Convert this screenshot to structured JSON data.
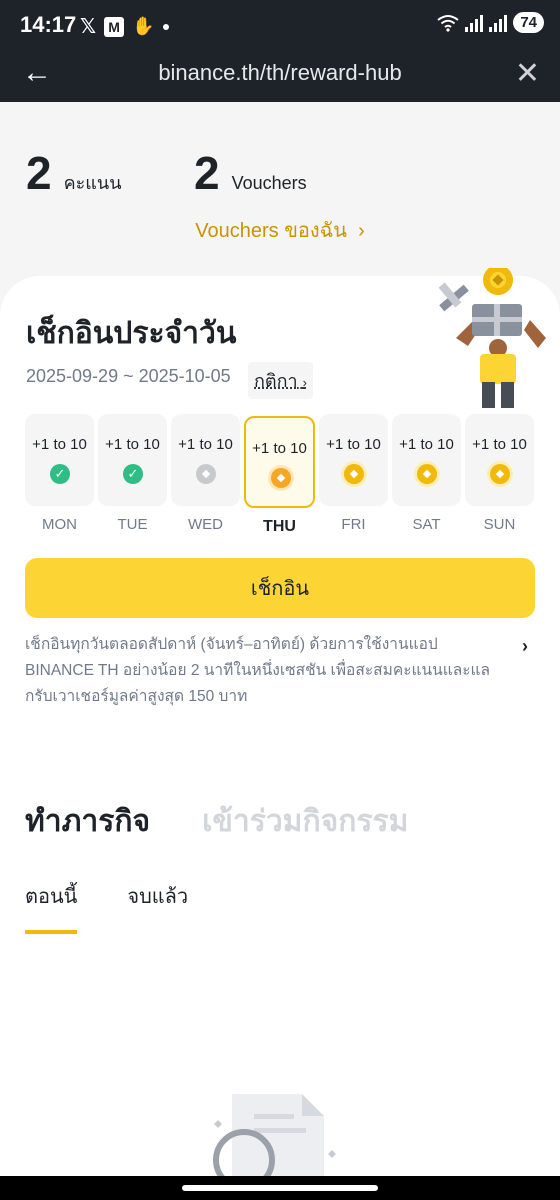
{
  "status_bar": {
    "time": "14:17",
    "battery": "74",
    "notification_icons": [
      "x-logo-icon",
      "m-app-icon",
      "waving-hand-icon",
      "dot-icon"
    ],
    "system_icons": [
      "wifi-icon",
      "signal-icon",
      "signal-icon",
      "battery-icon"
    ]
  },
  "browser": {
    "url": "binance.th/th/reward-hub",
    "back_icon": "back-arrow-icon",
    "close_icon": "close-icon"
  },
  "stats": {
    "points_value": "2",
    "points_label": "คะแนน",
    "vouchers_value": "2",
    "vouchers_label": "Vouchers",
    "my_vouchers_link": "Vouchers ของฉัน"
  },
  "checkin": {
    "title": "เช็กอินประจำวัน",
    "date_range": "2025-09-29 ~ 2025-10-05",
    "rules_link": "กติกา",
    "days": [
      {
        "points": "+1 to 10",
        "label": "MON",
        "state": "done"
      },
      {
        "points": "+1 to 10",
        "label": "TUE",
        "state": "done"
      },
      {
        "points": "+1 to 10",
        "label": "WED",
        "state": "missed"
      },
      {
        "points": "+1 to 10",
        "label": "THU",
        "state": "today"
      },
      {
        "points": "+1 to 10",
        "label": "FRI",
        "state": "future"
      },
      {
        "points": "+1 to 10",
        "label": "SAT",
        "state": "future"
      },
      {
        "points": "+1 to 10",
        "label": "SUN",
        "state": "future"
      }
    ],
    "button_label": "เช็กอิน",
    "description": "เช็กอินทุกวันตลอดสัปดาห์ (จันทร์–อาทิตย์) ด้วยการใช้งานแอป BINANCE TH อย่างน้อย 2 นาทีในหนึ่งเซสชัน เพื่อสะสมคะแนนและแลกรับเวาเชอร์มูลค่าสูงสุด 150 บาท"
  },
  "tasks": {
    "tab_active": "ทำภารกิจ",
    "tab_inactive": "เข้าร่วมกิจกรรม",
    "subtab_active": "ตอนนี้",
    "subtab_inactive": "จบแล้ว"
  },
  "colors": {
    "brand_yellow": "#fcd535",
    "accent_gold": "#c99400",
    "success_green": "#2ebd85",
    "dark_header": "#1e2329"
  }
}
